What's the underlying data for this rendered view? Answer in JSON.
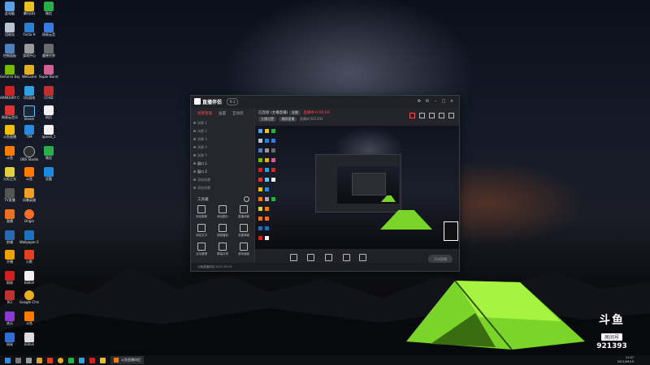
{
  "app": {
    "title": "直播伴侣",
    "version_chip": "9.1"
  },
  "left_pane": {
    "tabs": [
      "场景管理",
      "画面",
      "互动玩"
    ],
    "scenes": [
      "场景 1",
      "场景 2",
      "场景 3",
      "场景 4",
      "场景 5",
      "窗口 1",
      "窗口 2",
      "添加场景",
      "添加场景"
    ],
    "tools_title": "工具箱",
    "tools": [
      "添加摄像",
      "添加图片",
      "直播间管",
      "添加文字",
      "视频播放",
      "设置弹幕",
      "互动管理",
      "屏幕共享",
      "游戏画面",
      "更多",
      "更多",
      "更多"
    ]
  },
  "right_pane": {
    "header": {
      "title": "已连接 (主播直播)",
      "badge": "关播",
      "live_text": "直播中 0:00:00",
      "chips": [
        "主播设置",
        "横屏直播"
      ],
      "info": "直播间 921393"
    },
    "bottom_buttons": [
      "直播画面",
      "美颜",
      "美颜大师",
      "直播间",
      "混音台"
    ],
    "go_live": "开始直播"
  },
  "status_bar": {
    "text": "斗鱼直播伴侣 2021.09.19"
  },
  "taskbar": {
    "active_app": "斗鱼直播伴侣",
    "time": "11:07",
    "date": "2021/09/19"
  },
  "watermark": {
    "logo": "斗鱼",
    "room_label": "房间号",
    "room_number": "921393"
  },
  "desktop_icons": [
    "此电脑",
    "腾讯QQ",
    "微信",
    "回收站",
    "Forza H",
    "网易云音",
    "控制面板",
    "游戏中心",
    "魔兽世界",
    "GeForce Experience",
    "WeGame",
    "Super Bunny Man",
    "ARMOURY CRATE",
    "QQ游戏",
    "CFHD",
    "网易云音乐",
    "Steam",
    "网页",
    "斗鱼直播",
    "TIM",
    "apex4_1",
    "斗鱼",
    "OBS Studio",
    "微信",
    "优酷",
    "火炬之光",
    "斗鱼",
    "风暴英雄",
    "TV直播",
    "直播",
    "Origin",
    "剪辑",
    "Wallpaper Engine",
    "开播",
    "火影",
    "网易",
    "斗鱼",
    "Bilibili",
    "RCI",
    "Google Chrome",
    "腾讯",
    "欢乐",
    "斗鱼",
    "网易",
    "Bilibili"
  ]
}
